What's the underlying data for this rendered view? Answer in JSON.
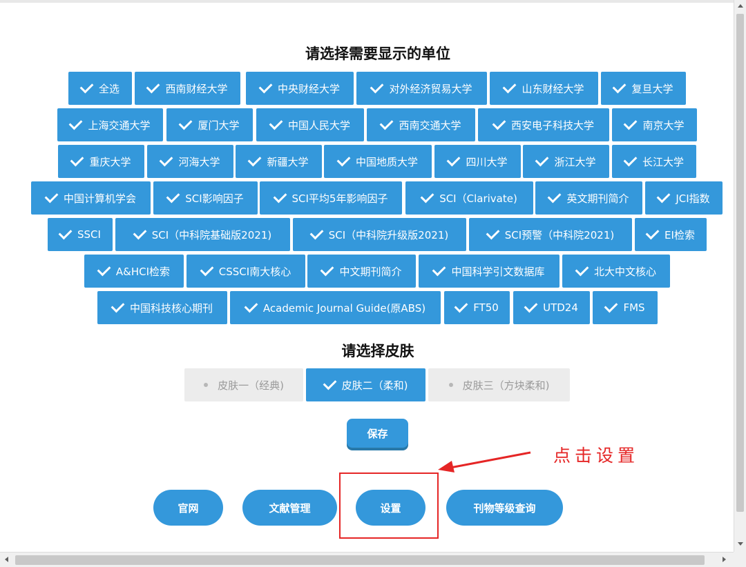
{
  "units": {
    "title": "请选择需要显示的单位",
    "rows": [
      [
        "全选",
        "西南财经大学",
        "中央财经大学",
        "对外经济贸易大学",
        "山东财经大学",
        "复旦大学"
      ],
      [
        "上海交通大学",
        "厦门大学",
        "中国人民大学",
        "西南交通大学",
        "西安电子科技大学",
        "南京大学"
      ],
      [
        "重庆大学",
        "河海大学",
        "新疆大学",
        "中国地质大学",
        "四川大学",
        "浙江大学",
        "长江大学"
      ],
      [
        "中国计算机学会",
        "SCI影响因子",
        "SCI平均5年影响因子",
        "SCI（Clarivate)",
        "英文期刊简介",
        "JCI指数"
      ],
      [
        "SSCI",
        "SCI（中科院基础版2021)",
        "SCI（中科院升级版2021)",
        "SCI预警（中科院2021)",
        "EI检索"
      ],
      [
        "A&HCI检索",
        "CSSCI南大核心",
        "中文期刊简介",
        "中国科学引文数据库",
        "北大中文核心"
      ],
      [
        "中国科技核心期刊",
        "Academic Journal Guide(原ABS)",
        "FT50",
        "UTD24",
        "FMS"
      ]
    ]
  },
  "skin": {
    "title": "请选择皮肤",
    "options": [
      {
        "label": "皮肤一（经典)",
        "selected": false
      },
      {
        "label": "皮肤二（柔和)",
        "selected": true
      },
      {
        "label": "皮肤三（方块柔和)",
        "selected": false
      }
    ]
  },
  "save_label": "保存",
  "nav": {
    "official": "官网",
    "docs": "文献管理",
    "settings": "设置",
    "journal_query": "刊物等级查询"
  },
  "annotation": "点击设置",
  "colors": {
    "accent": "#3498db",
    "annotation": "#e52525",
    "unselected": "#ececec"
  }
}
